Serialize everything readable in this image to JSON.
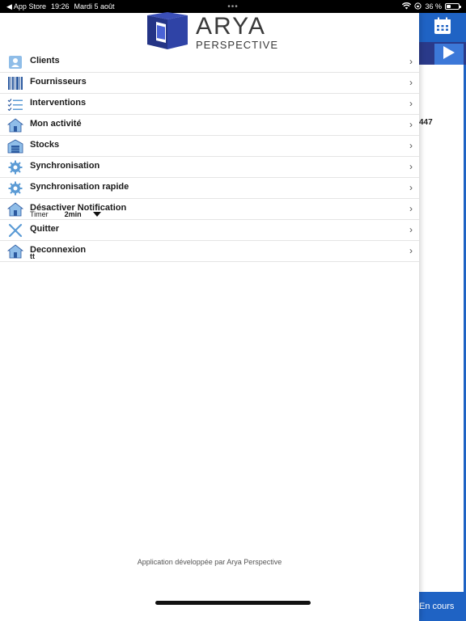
{
  "status_bar": {
    "back_app": "◀ App Store",
    "time": "19:26",
    "date": "Mardi 5 août",
    "dots": "•••",
    "battery_pct": "36 %",
    "battery_level": 0.36
  },
  "logo": {
    "title": "ARYA",
    "subtitle": "PERSPECTIVE"
  },
  "menu": {
    "items": [
      {
        "label": "Clients",
        "icon": "user-icon"
      },
      {
        "label": "Fournisseurs",
        "icon": "barcode-icon"
      },
      {
        "label": "Interventions",
        "icon": "checklist-icon"
      },
      {
        "label": "Mon activité",
        "icon": "home-icon"
      },
      {
        "label": "Stocks",
        "icon": "warehouse-icon"
      },
      {
        "label": "Synchronisation",
        "icon": "gear-icon"
      },
      {
        "label": "Synchronisation rapide",
        "icon": "gear-icon"
      },
      {
        "label": "Désactiver Notification",
        "icon": "home-icon",
        "timer_label": "Timer",
        "timer_value": "2min"
      },
      {
        "label": "Quitter",
        "icon": "close-icon"
      },
      {
        "label": "Deconnexion",
        "icon": "home-icon",
        "user": "tt"
      }
    ]
  },
  "footer": "Application développée par Arya Perspective",
  "background": {
    "number": "447",
    "bottom_label": "En cours"
  },
  "colors": {
    "accent": "#1f63c4",
    "dark_accent": "#2a3a8a",
    "icon_blue": "#5b9bd5"
  }
}
